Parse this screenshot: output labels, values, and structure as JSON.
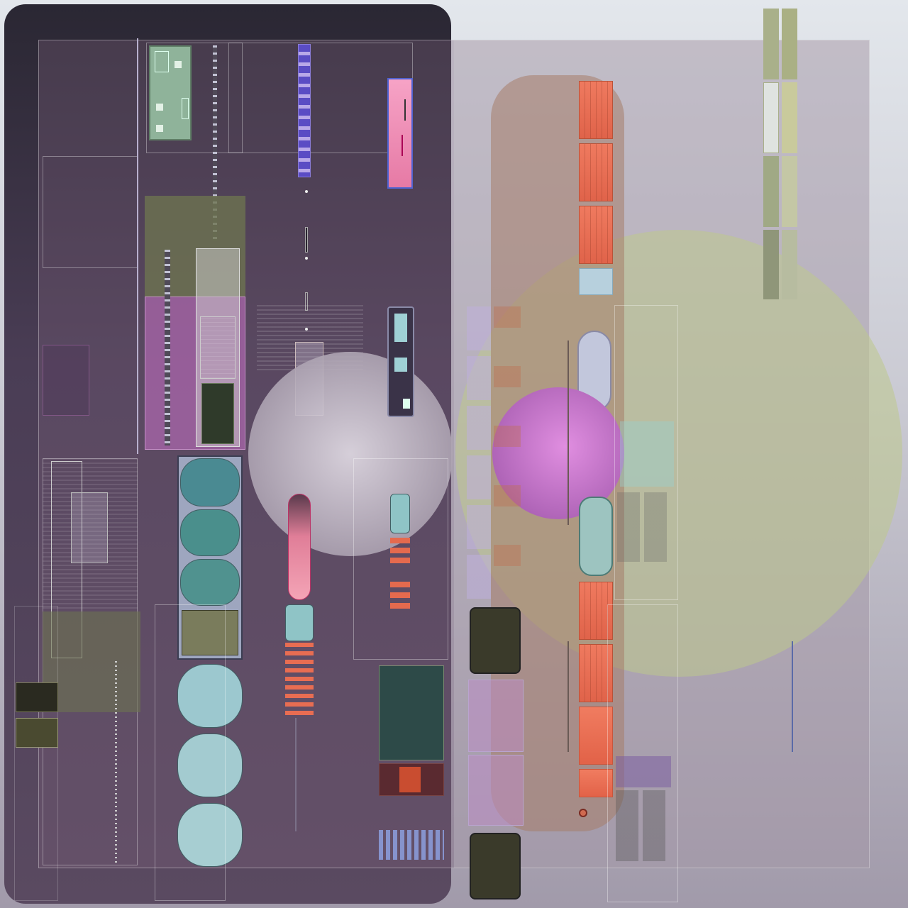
{
  "title": "",
  "colors": {
    "dark_panel": "#4a3d55",
    "pink_accent": "#f6a3c6",
    "orange_module": "#ef7a5f",
    "teal_module": "#8fc4c6",
    "purple_glow": "#d084d6",
    "olive_glow": "#bec88c",
    "background_top": "#e3e7ec",
    "background_bottom": "#a19aaa"
  },
  "icons": {
    "orange_modules": "grille-icon",
    "teal_modules": "socket-panel-icon",
    "pill_sockets": "round-socket-icon"
  }
}
